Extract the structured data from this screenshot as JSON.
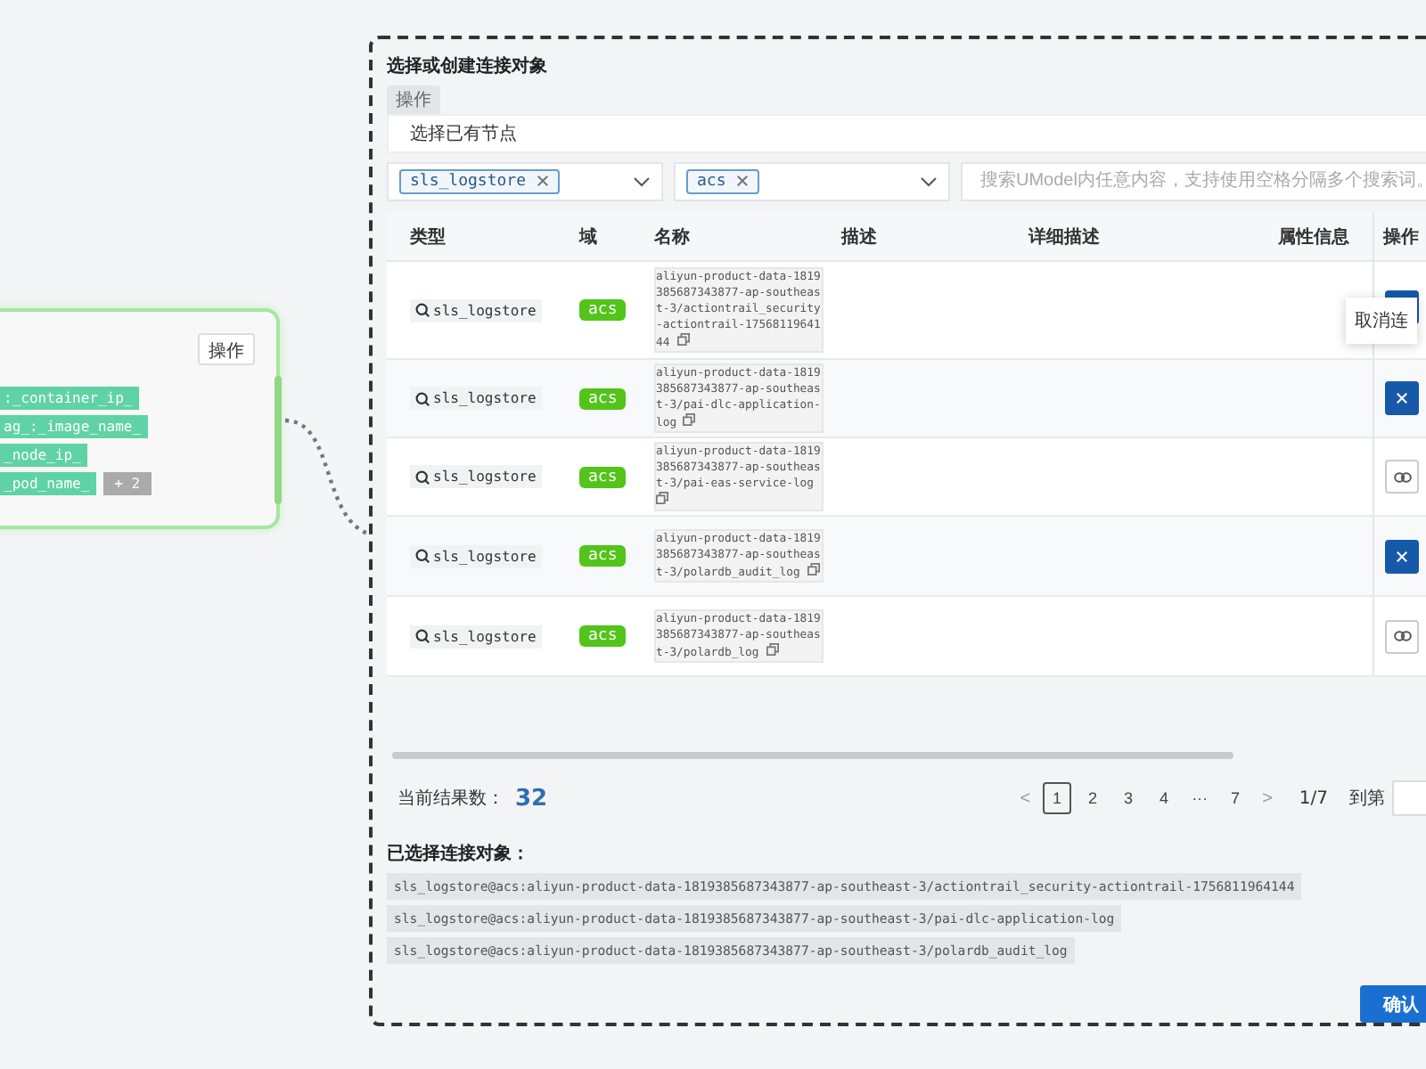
{
  "node_card": {
    "action_button": "操作",
    "tags": [
      ":_container_ip_",
      "ag_:_image_name_",
      "_node_ip_",
      "_pod_name_"
    ],
    "more_count": "+ 2"
  },
  "panel": {
    "title": "选择或创建连接对象",
    "tab": "操作",
    "mode": "选择已有节点",
    "filters": [
      {
        "chip": "sls_logstore"
      },
      {
        "chip": "acs"
      }
    ],
    "search": {
      "placeholder": "搜索UModel内任意内容，支持使用空格分隔多个搜索词。"
    },
    "columns": [
      "类型",
      "域",
      "名称",
      "描述",
      "详细描述",
      "属性信息",
      "操作"
    ],
    "rows": [
      {
        "type": "sls_logstore",
        "domain": "acs",
        "name": "aliyun-product-data-1819385687343877-ap-southeast-3/actiontrail_security-actiontrail-1756811964144",
        "selected": true
      },
      {
        "type": "sls_logstore",
        "domain": "acs",
        "name": "aliyun-product-data-1819385687343877-ap-southeast-3/pai-dlc-application-log",
        "selected": true
      },
      {
        "type": "sls_logstore",
        "domain": "acs",
        "name": "aliyun-product-data-1819385687343877-ap-southeast-3/pai-eas-service-log",
        "selected": false
      },
      {
        "type": "sls_logstore",
        "domain": "acs",
        "name": "aliyun-product-data-1819385687343877-ap-southeast-3/polardb_audit_log",
        "selected": true
      },
      {
        "type": "sls_logstore",
        "domain": "acs",
        "name": "aliyun-product-data-1819385687343877-ap-southeast-3/polardb_log",
        "selected": false
      }
    ],
    "tooltip": "取消连",
    "result_label": "当前结果数：",
    "result_count": "32",
    "pagination": {
      "prev": "<",
      "pages": [
        {
          "label": "1",
          "selected": true
        },
        {
          "label": "2",
          "selected": false
        },
        {
          "label": "3",
          "selected": false
        },
        {
          "label": "4",
          "selected": false
        },
        {
          "label": "···",
          "selected": false
        },
        {
          "label": "7",
          "selected": false
        }
      ],
      "next": ">",
      "summary": "1/7",
      "goto_label": "到第"
    },
    "selected_label": "已选择连接对象：",
    "selected_items": [
      "sls_logstore@acs:aliyun-product-data-1819385687343877-ap-southeast-3/actiontrail_security-actiontrail-1756811964144",
      "sls_logstore@acs:aliyun-product-data-1819385687343877-ap-southeast-3/pai-dlc-application-log",
      "sls_logstore@acs:aliyun-product-data-1819385687343877-ap-southeast-3/polardb_audit_log"
    ],
    "confirm": "确认"
  }
}
